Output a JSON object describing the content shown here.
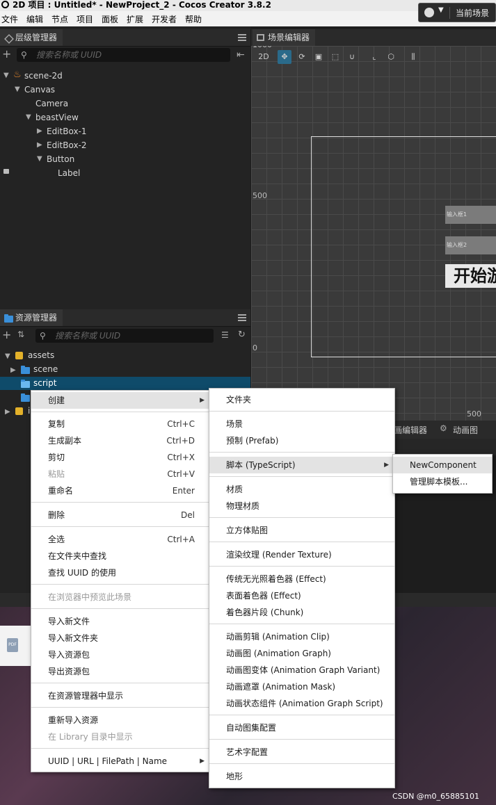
{
  "title_bar": {
    "text": "2D 项目 : Untitled* - NewProject_2 - Cocos Creator 3.8.2"
  },
  "menubar": {
    "items": [
      "文件",
      "编辑",
      "节点",
      "项目",
      "面板",
      "扩展",
      "开发者",
      "帮助"
    ],
    "scene_button": "当前场景"
  },
  "hierarchy": {
    "tab": "层级管理器",
    "search_placeholder": "搜索名称或 UUID",
    "nodes": [
      "scene-2d",
      "Canvas",
      "Camera",
      "beastView",
      "EditBox-1",
      "EditBox-2",
      "Button",
      "Label"
    ]
  },
  "scene_editor": {
    "tab": "场景编辑器",
    "toolbar_2d": "2D",
    "ruler": {
      "top": "1000",
      "mid": "500",
      "zero": "0",
      "bottom": "500"
    },
    "editbox1": "输入框1",
    "editbox2": "输入框2",
    "start_text": "开始游",
    "bottom_tabs": [
      "画编辑器",
      "动画图"
    ]
  },
  "assets": {
    "tab": "资源管理器",
    "search_placeholder": "搜索名称或 UUID",
    "items": [
      "assets",
      "scene",
      "script"
    ],
    "partial_labels": [
      "i"
    ]
  },
  "context_menu": {
    "items": [
      {
        "label": "创建",
        "shortcut": "",
        "submenu": true
      },
      {
        "label": "复制",
        "shortcut": "Ctrl+C"
      },
      {
        "label": "生成副本",
        "shortcut": "Ctrl+D"
      },
      {
        "label": "剪切",
        "shortcut": "Ctrl+X"
      },
      {
        "label": "粘贴",
        "shortcut": "Ctrl+V"
      },
      {
        "label": "重命名",
        "shortcut": "Enter"
      },
      {
        "label": "删除",
        "shortcut": "Del"
      },
      {
        "label": "全选",
        "shortcut": "Ctrl+A"
      },
      {
        "label": "在文件夹中查找",
        "shortcut": ""
      },
      {
        "label": "查找 UUID 的使用",
        "shortcut": ""
      },
      {
        "label": "在浏览器中预览此场景",
        "shortcut": ""
      },
      {
        "label": "导入新文件",
        "shortcut": ""
      },
      {
        "label": "导入新文件夹",
        "shortcut": ""
      },
      {
        "label": "导入资源包",
        "shortcut": ""
      },
      {
        "label": "导出资源包",
        "shortcut": ""
      },
      {
        "label": "在资源管理器中显示",
        "shortcut": ""
      },
      {
        "label": "重新导入资源",
        "shortcut": ""
      },
      {
        "label": "在 Library 目录中显示",
        "shortcut": ""
      },
      {
        "label": "UUID | URL | FilePath | Name",
        "shortcut": "",
        "submenu": true
      }
    ]
  },
  "create_submenu": {
    "items": [
      "文件夹",
      "场景",
      "预制 (Prefab)",
      "脚本 (TypeScript)",
      "材质",
      "物理材质",
      "立方体贴图",
      "渲染纹理 (Render Texture)",
      "传统无光照着色器 (Effect)",
      "表面着色器 (Effect)",
      "着色器片段 (Chunk)",
      "动画剪辑 (Animation Clip)",
      "动画图 (Animation Graph)",
      "动画图变体 (Animation Graph Variant)",
      "动画遮罩 (Animation Mask)",
      "动画状态组件 (Animation Graph Script)",
      "自动图集配置",
      "艺术字配置",
      "地形"
    ]
  },
  "script_submenu": {
    "items": [
      "NewComponent",
      "管理脚本模板..."
    ]
  },
  "background": {
    "pdf_label": "PDF"
  },
  "watermark": "CSDN @m0_65885101"
}
